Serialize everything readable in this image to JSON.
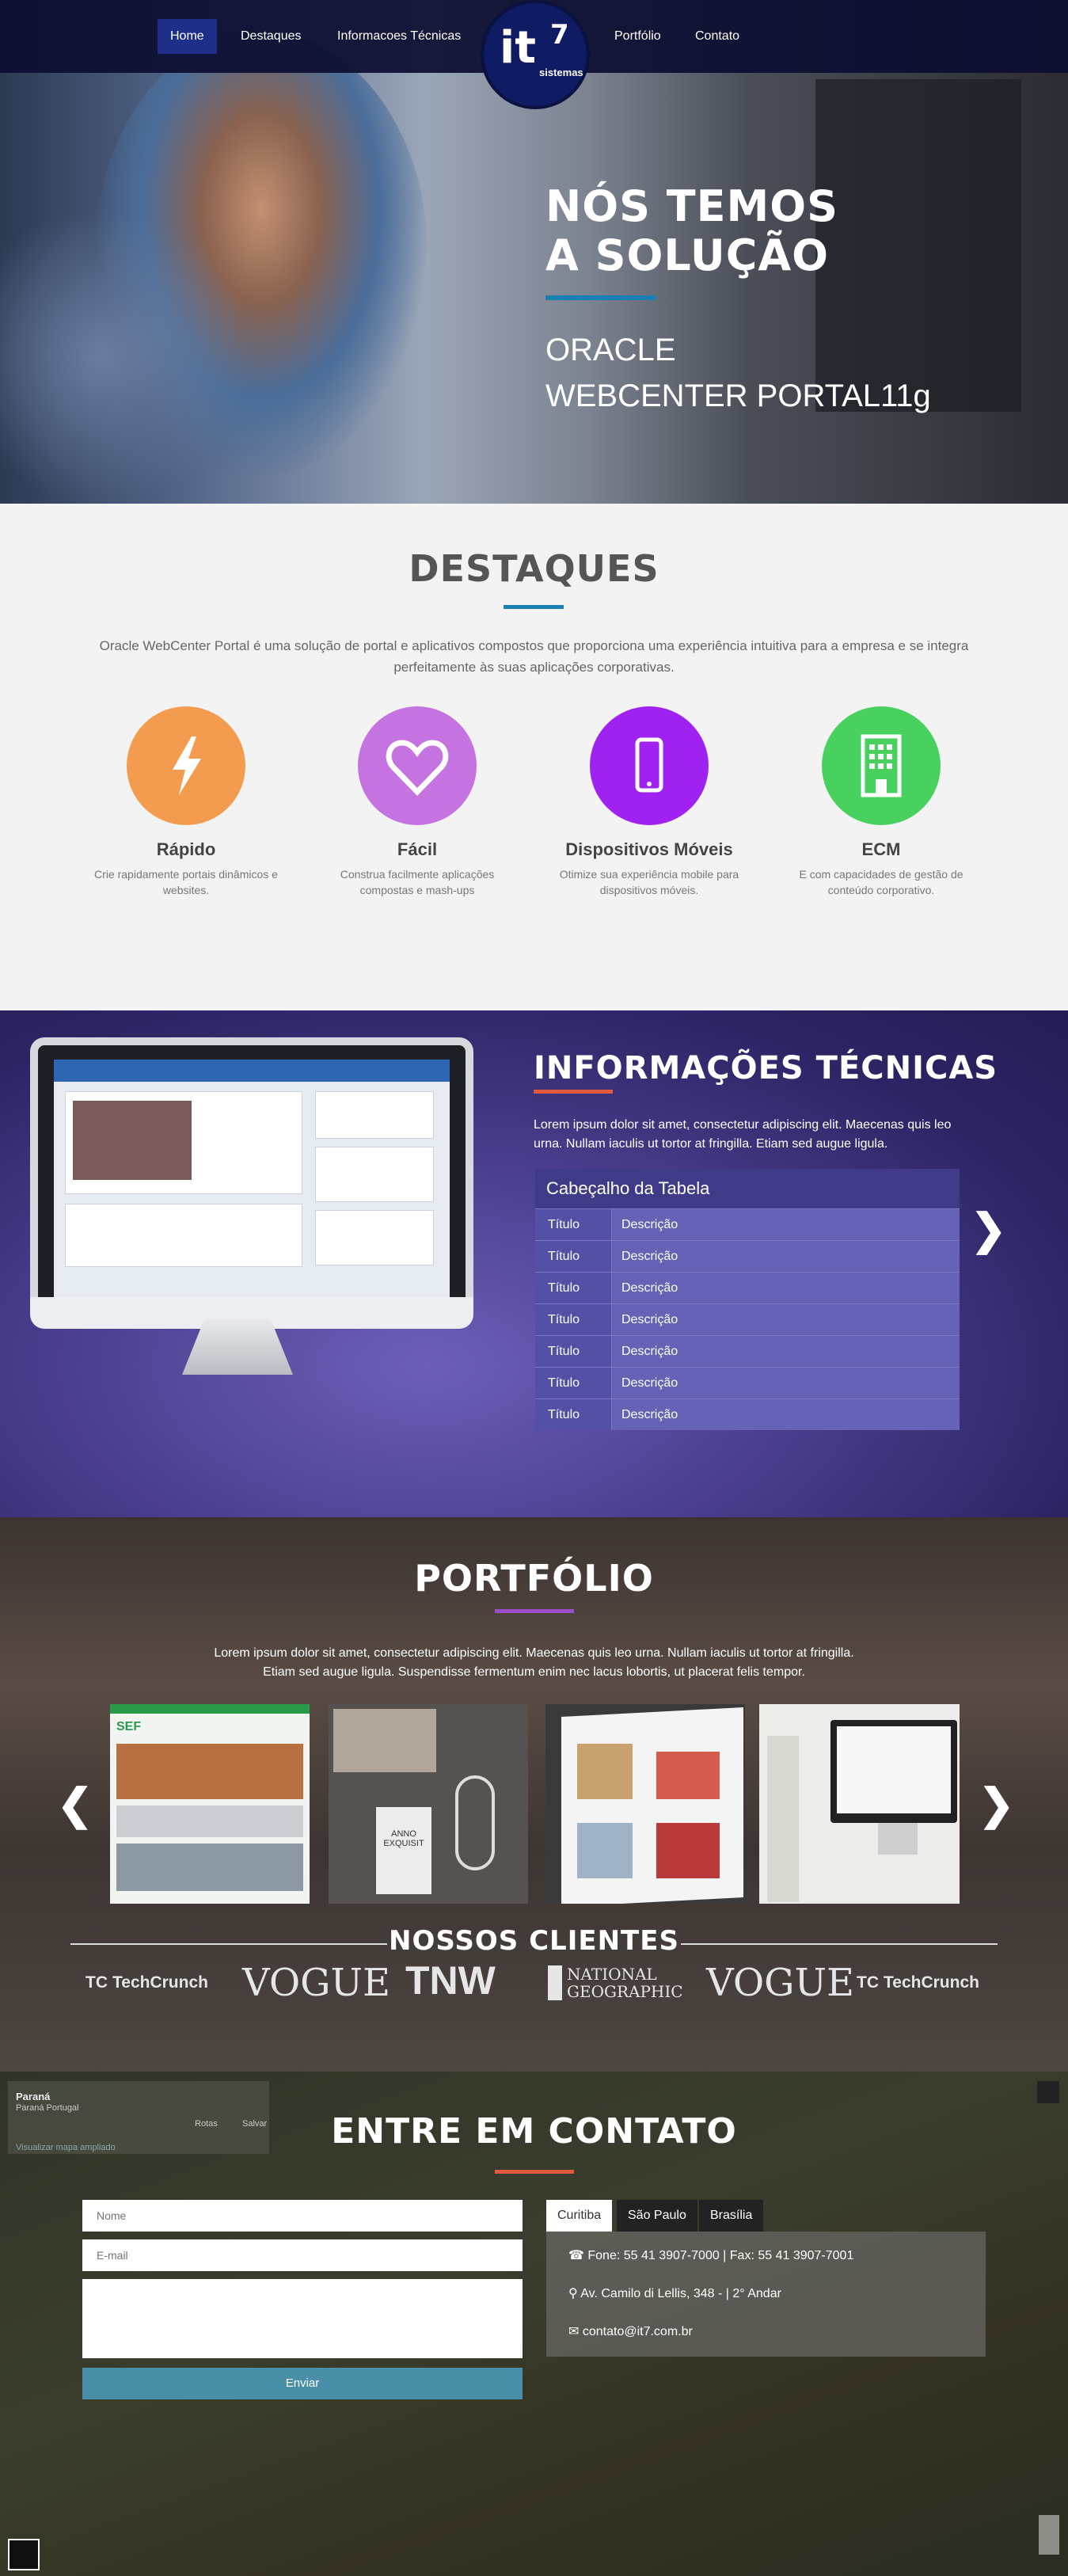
{
  "nav": {
    "items": [
      "Home",
      "Destaques",
      "Informacoes Técnicas",
      "Portfólio",
      "Contato"
    ],
    "logo_big": "it",
    "logo_sup": "7",
    "logo_small": "sistemas"
  },
  "hero": {
    "title_line1": "NÓS TEMOS",
    "title_line2": "A SOLUÇÃO",
    "sub1": "ORACLE",
    "sub2": "WEBCENTER PORTAL11g"
  },
  "destaques": {
    "title": "DESTAQUES",
    "desc": "Oracle WebCenter Portal é uma solução de portal e aplicativos compostos que proporciona uma experiência intuitiva para a empresa e se integra perfeitamente às suas aplicações corporativas.",
    "features": [
      {
        "name": "Rápido",
        "desc": "Crie rapidamente portais dinâmicos e websites.",
        "icon": "lightning-icon",
        "color": "#f39c4f"
      },
      {
        "name": "Fácil",
        "desc": "Construa facilmente aplicações compostas e mash-ups",
        "icon": "heart-icon",
        "color": "#c473e0"
      },
      {
        "name": "Dispositivos Móveis",
        "desc": "Otimize sua experiência mobile para dispositivos móveis.",
        "icon": "mobile-icon",
        "color": "#a022f0"
      },
      {
        "name": "ECM",
        "desc": "E com capacidades de gestão de conteúdo corporativo.",
        "icon": "building-icon",
        "color": "#49d160"
      }
    ]
  },
  "info": {
    "title": "INFORMAÇÕES TÉCNICAS",
    "desc": "Lorem ipsum dolor sit amet, consectetur adipiscing elit. Maecenas quis leo urna. Nullam iaculis ut tortor at fringilla. Etiam sed augue ligula.",
    "table_header": "Cabeçalho da Tabela",
    "rows": [
      [
        "Título",
        "Descrição"
      ],
      [
        "Título",
        "Descrição"
      ],
      [
        "Título",
        "Descrição"
      ],
      [
        "Título",
        "Descrição"
      ],
      [
        "Título",
        "Descrição"
      ],
      [
        "Título",
        "Descrição"
      ],
      [
        "Título",
        "Descrição"
      ]
    ],
    "next": "❯"
  },
  "portfolio": {
    "title": "PORTFÓLIO",
    "desc_line1": "Lorem ipsum dolor sit amet, consectetur adipiscing elit. Maecenas quis leo urna. Nullam iaculis ut tortor at fringilla.",
    "desc_line2": "Etiam sed augue ligula. Suspendisse fermentum enim nec lacus lobortis, ut placerat felis tempor.",
    "prev": "❮",
    "next": "❯",
    "thumb1_label": "SEF",
    "thumb2_label": "ANNO EXQUISIT"
  },
  "clients": {
    "title": "NOSSOS CLIENTES",
    "logos": [
      "TechCrunch",
      "VOGUE",
      "TNW",
      "NATIONAL GEOGRAPHIC",
      "VOGUE",
      "TechCrunch"
    ],
    "logo_prefix": "TC"
  },
  "contact": {
    "title": "ENTRE EM CONTATO",
    "name_placeholder": "Nome",
    "email_placeholder": "E-mail",
    "send": "Enviar",
    "tabs": [
      "Curitiba",
      "São Paulo",
      "Brasília"
    ],
    "phone": "Fone: 55 41 3907-7000 | Fax: 55 41 3907-7001",
    "address": "Av. Camilo di Lellis, 348 - | 2° Andar",
    "email": "contato@it7.com.br",
    "map": {
      "place": "Paraná",
      "region": "Paraná Portugal",
      "link": "Visualizar mapa ampliado",
      "route": "Rotas",
      "save": "Salvar"
    }
  }
}
